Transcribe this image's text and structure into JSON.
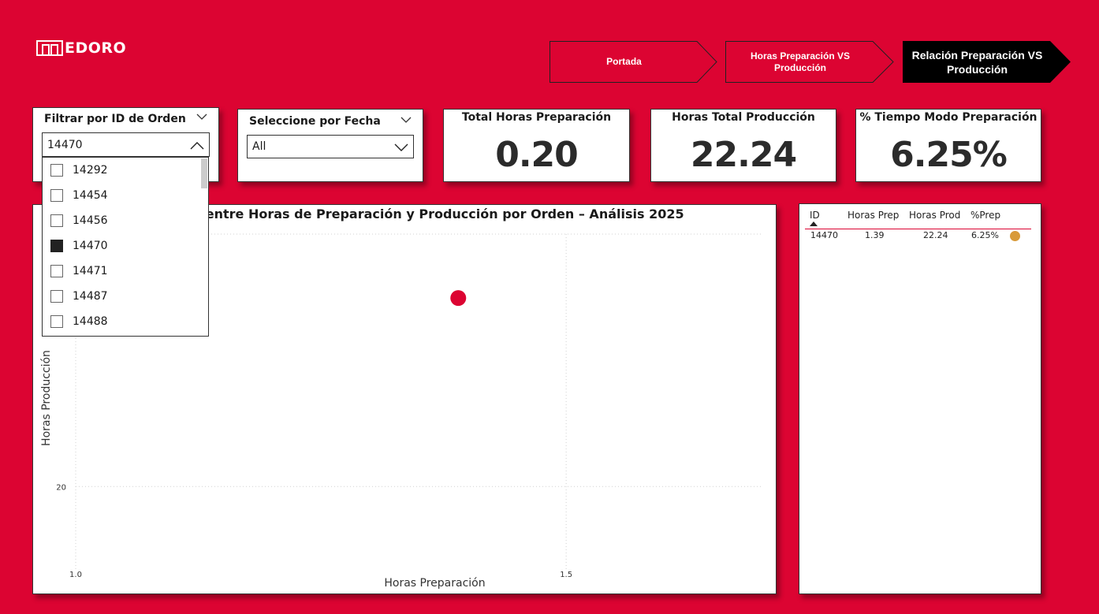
{
  "brand": {
    "logo_text": "EDORO"
  },
  "nav": [
    {
      "label": "Portada",
      "active": false
    },
    {
      "label": "Horas Preparación VS Producción",
      "active": false
    },
    {
      "label": "Relación Preparación VS Producción",
      "active": true
    }
  ],
  "filter_order": {
    "title": "Filtrar por ID de Orden",
    "selected": "14470",
    "options": [
      {
        "label": "14292",
        "checked": false
      },
      {
        "label": "14454",
        "checked": false
      },
      {
        "label": "14456",
        "checked": false
      },
      {
        "label": "14470",
        "checked": true
      },
      {
        "label": "14471",
        "checked": false
      },
      {
        "label": "14487",
        "checked": false
      },
      {
        "label": "14488",
        "checked": false
      }
    ]
  },
  "filter_date": {
    "title": "Seleccione por Fecha",
    "selected": "All"
  },
  "kpis": [
    {
      "title": "Total Horas Preparación",
      "value": "0.20"
    },
    {
      "title": "Horas Total Producción",
      "value": "22.24"
    },
    {
      "title": "% Tiempo Modo Preparación",
      "value": "6.25%"
    }
  ],
  "chart_data": {
    "type": "scatter",
    "title": "Relación entre Horas de Preparación y Producción por Orden – Análisis 2025",
    "xlabel": "Horas Preparación",
    "ylabel": "Horas Producción",
    "x_ticks": [
      "1.0",
      "1.5"
    ],
    "y_ticks": [
      "20"
    ],
    "xlim": [
      1.0,
      1.7
    ],
    "ylim": [
      19,
      23
    ],
    "grid": true,
    "points": [
      {
        "x": 1.39,
        "y": 22.24
      }
    ],
    "color": "#DC0432"
  },
  "table": {
    "headers": [
      "ID",
      "Horas Prep",
      "Horas Prod",
      "%Prep"
    ],
    "rows": [
      {
        "id": "14470",
        "prep": "1.39",
        "prod": "22.24",
        "pct": "6.25%",
        "indicator_color": "#D89A3A"
      }
    ]
  },
  "colors": {
    "background": "#DC0432",
    "nav_active": "#000000"
  }
}
